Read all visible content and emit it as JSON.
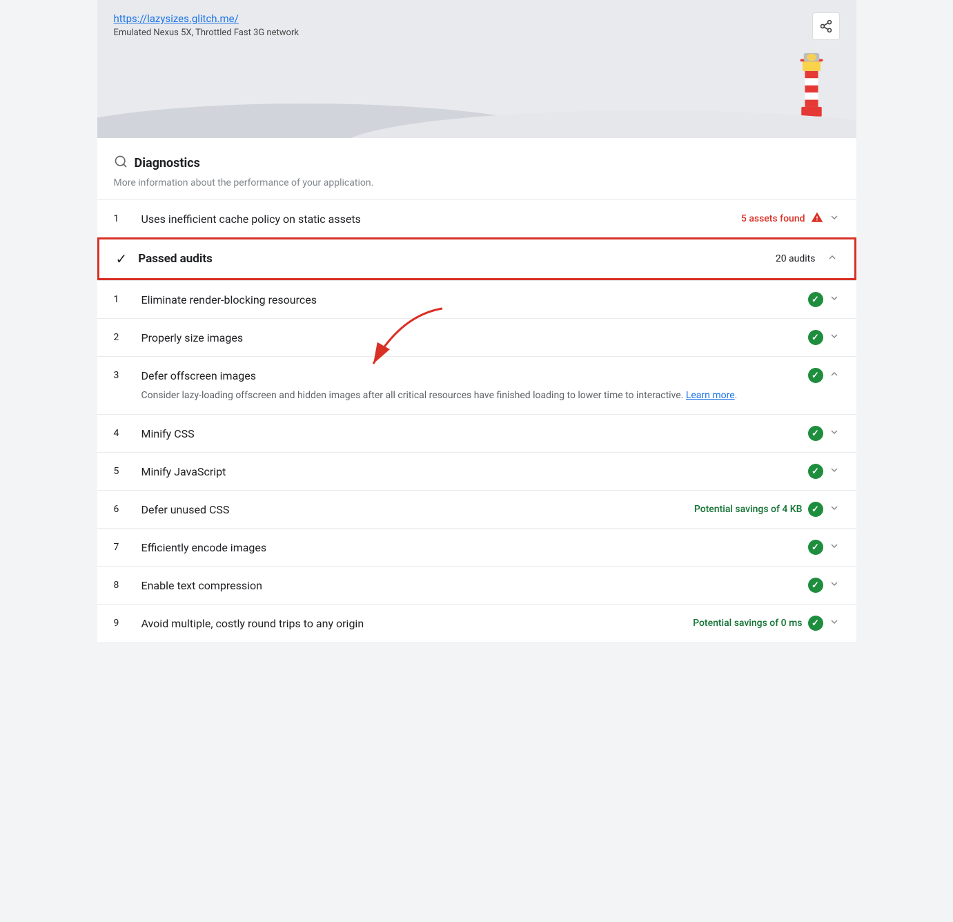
{
  "header": {
    "url": "https://lazysizes.glitch.me/",
    "subtitle": "Emulated Nexus 5X, Throttled Fast 3G network",
    "share_label": "share"
  },
  "diagnostics": {
    "title": "Diagnostics",
    "subtitle": "More information about the performance of your application.",
    "icon": "🔍",
    "items": [
      {
        "number": "1",
        "label": "Uses inefficient cache policy on static assets",
        "badge": "5 assets found",
        "badge_type": "warning"
      }
    ]
  },
  "passed_audits": {
    "title": "Passed audits",
    "count": "20 audits"
  },
  "audit_items": [
    {
      "number": "1",
      "label": "Eliminate render-blocking resources",
      "type": "pass"
    },
    {
      "number": "2",
      "label": "Properly size images",
      "type": "pass"
    },
    {
      "number": "3",
      "label": "Defer offscreen images",
      "type": "pass_expanded",
      "description": "Consider lazy-loading offscreen and hidden images after all critical resources have finished loading to lower time to interactive.",
      "learn_more_text": "Learn more"
    },
    {
      "number": "4",
      "label": "Minify CSS",
      "type": "pass"
    },
    {
      "number": "5",
      "label": "Minify JavaScript",
      "type": "pass"
    },
    {
      "number": "6",
      "label": "Defer unused CSS",
      "type": "pass_savings",
      "savings": "Potential savings of 4 KB"
    },
    {
      "number": "7",
      "label": "Efficiently encode images",
      "type": "pass"
    },
    {
      "number": "8",
      "label": "Enable text compression",
      "type": "pass"
    },
    {
      "number": "9",
      "label": "Avoid multiple, costly round trips to any origin",
      "type": "pass_savings",
      "savings": "Potential savings of 0 ms"
    }
  ],
  "colors": {
    "warning_red": "#d93025",
    "pass_green": "#1e8e3e",
    "savings_green": "#137333",
    "link_blue": "#1a73e8",
    "border_red": "#d93025"
  }
}
